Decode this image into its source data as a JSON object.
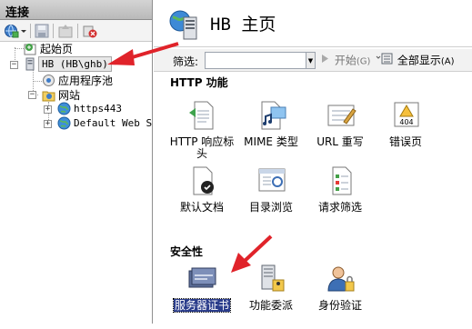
{
  "connections": {
    "header": "连接",
    "toolbar": [
      "globe-connect-icon",
      "save-icon",
      "up-icon",
      "disconnect-icon"
    ],
    "tree": {
      "start_page": "起始页",
      "server": "HB (HB\\ghb)",
      "app_pools": "应用程序池",
      "sites": "网站",
      "site1": "https443",
      "site2": "Default Web S"
    }
  },
  "page": {
    "title": "HB 主页"
  },
  "filter": {
    "label": "筛选:",
    "value": "",
    "start_label": "开始",
    "start_shortcut": "(G)",
    "show_all_label": "全部显示",
    "show_all_shortcut": "(A)"
  },
  "sections": {
    "http": {
      "title": "HTTP 功能",
      "features": [
        "HTTP 响应标头",
        "MIME 类型",
        "URL 重写",
        "错误页",
        "默认文档",
        "目录浏览",
        "请求筛选"
      ]
    },
    "security": {
      "title": "安全性",
      "features": [
        "服务器证书",
        "功能委派",
        "身份验证"
      ]
    }
  },
  "error_icon_text": "404",
  "colors": {
    "selection": "#2a3c8b",
    "arrow": "#e0232a",
    "header_bg": "#c4c4c4"
  }
}
